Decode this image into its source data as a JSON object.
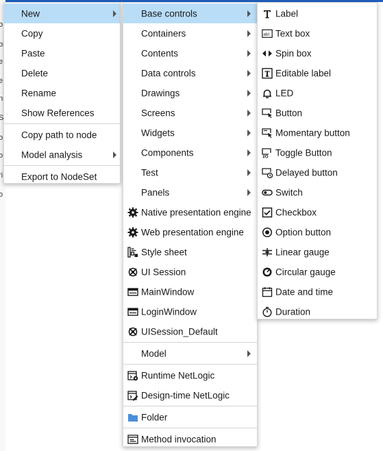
{
  "menu1": {
    "items": [
      {
        "label": "New",
        "submenu": true,
        "highlighted": true
      },
      {
        "label": "Copy"
      },
      {
        "label": "Paste"
      },
      {
        "label": "Delete"
      },
      {
        "label": "Rename"
      },
      {
        "label": "Show References"
      },
      {
        "separator": true
      },
      {
        "label": "Copy path to node"
      },
      {
        "label": "Model analysis",
        "submenu": true
      },
      {
        "separator": true
      },
      {
        "label": "Export to NodeSet"
      }
    ]
  },
  "menu2": {
    "items": [
      {
        "label": "Base controls",
        "submenu": true,
        "highlighted": true
      },
      {
        "label": "Containers",
        "submenu": true
      },
      {
        "label": "Contents",
        "submenu": true
      },
      {
        "label": "Data controls",
        "submenu": true
      },
      {
        "label": "Drawings",
        "submenu": true
      },
      {
        "label": "Screens",
        "submenu": true
      },
      {
        "label": "Widgets",
        "submenu": true
      },
      {
        "label": "Components",
        "submenu": true
      },
      {
        "label": "Test",
        "submenu": true
      },
      {
        "label": "Panels",
        "submenu": true
      },
      {
        "label": "Native presentation engine",
        "icon": "gear-icon"
      },
      {
        "label": "Web presentation engine",
        "icon": "gear-icon"
      },
      {
        "label": "Style sheet",
        "icon": "stylesheet-icon"
      },
      {
        "label": "UI Session",
        "icon": "session-icon"
      },
      {
        "label": "MainWindow",
        "icon": "window-icon"
      },
      {
        "label": "LoginWindow",
        "icon": "window-icon"
      },
      {
        "label": "UISession_Default",
        "icon": "session-icon"
      },
      {
        "separator": true
      },
      {
        "label": "Model",
        "submenu": true
      },
      {
        "separator": true
      },
      {
        "label": "Runtime NetLogic",
        "icon": "runtime-netlogic-icon"
      },
      {
        "label": "Design-time NetLogic",
        "icon": "designtime-netlogic-icon"
      },
      {
        "separator": true
      },
      {
        "label": "Folder",
        "icon": "folder-icon"
      },
      {
        "separator": true
      },
      {
        "label": "Method invocation",
        "icon": "method-invocation-icon"
      }
    ]
  },
  "menu3": {
    "items": [
      {
        "label": "Label",
        "icon": "label-icon"
      },
      {
        "label": "Text box",
        "icon": "textbox-icon"
      },
      {
        "label": "Spin box",
        "icon": "spinbox-icon"
      },
      {
        "label": "Editable label",
        "icon": "editable-label-icon"
      },
      {
        "label": "LED",
        "icon": "led-icon"
      },
      {
        "label": "Button",
        "icon": "button-icon"
      },
      {
        "label": "Momentary button",
        "icon": "momentary-button-icon"
      },
      {
        "label": "Toggle Button",
        "icon": "toggle-button-icon"
      },
      {
        "label": "Delayed button",
        "icon": "delayed-button-icon"
      },
      {
        "label": "Switch",
        "icon": "switch-icon"
      },
      {
        "label": "Checkbox",
        "icon": "checkbox-icon"
      },
      {
        "label": "Option button",
        "icon": "option-button-icon"
      },
      {
        "label": "Linear gauge",
        "icon": "linear-gauge-icon"
      },
      {
        "label": "Circular gauge",
        "icon": "circular-gauge-icon"
      },
      {
        "label": "Date and time",
        "icon": "date-time-icon"
      },
      {
        "label": "Duration",
        "icon": "duration-icon"
      }
    ]
  },
  "background": {
    "fragments": [
      "o",
      "ol",
      "e",
      "e",
      "ns",
      "S",
      "o",
      "o",
      "ri",
      "o"
    ]
  },
  "colors": {
    "highlight": "#b9ddf7",
    "folder": "#4a8fd8",
    "accent": "#1f5fbf"
  }
}
